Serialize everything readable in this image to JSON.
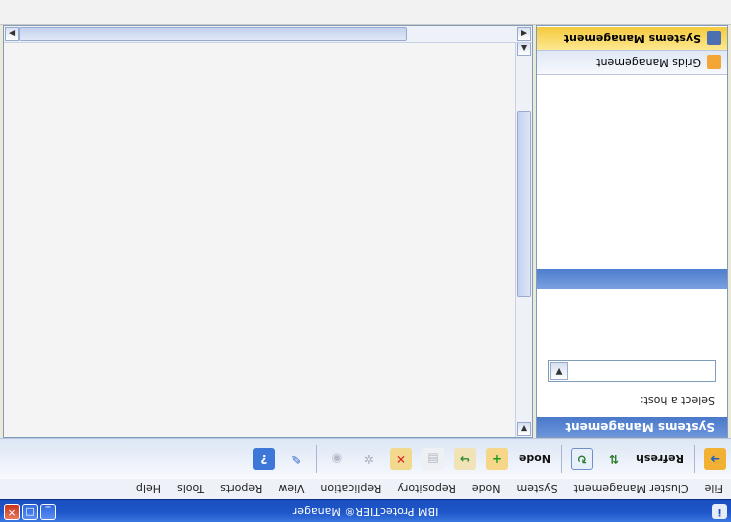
{
  "window": {
    "title": "IBM ProtecTIER® Manager",
    "app_icon": "ibm-app-icon",
    "controls": [
      "minimize-icon",
      "maximize-icon",
      "close-icon"
    ]
  },
  "menu": {
    "items": [
      "File",
      "Cluster Management",
      "System",
      "Node",
      "Repository",
      "Replication",
      "View",
      "Reports",
      "Tools",
      "Help"
    ]
  },
  "toolbar": {
    "refresh_label": "Refresh",
    "node_label": "Node"
  },
  "left_panel": {
    "header": "Systems Management",
    "host_label": "Select a host:",
    "host_value": "",
    "nav": {
      "grids": "Grids Management",
      "systems": "Systems Management"
    }
  },
  "colors": {
    "titlebar": "#1e56c9",
    "selected_nav": "#f4c93c",
    "panel_header": "#4a79ca"
  }
}
